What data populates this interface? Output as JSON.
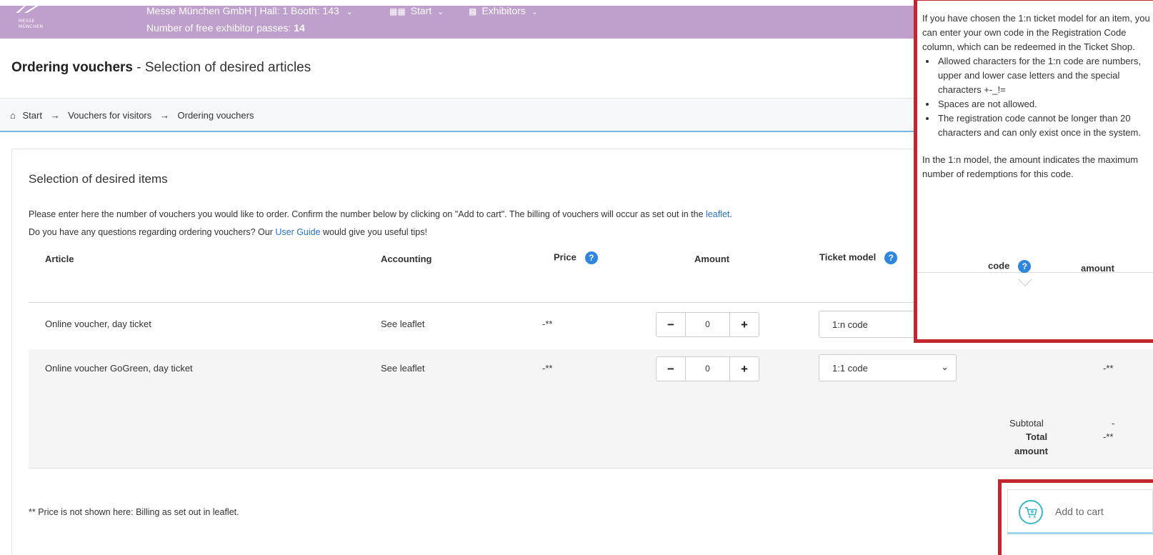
{
  "header": {
    "logo_line1": "MESSE",
    "logo_line2": "MÜNCHEN",
    "company": "Messe München GmbH | Hall: 1 Booth: 143",
    "free_passes_label": "Number of free exhibitor passes:",
    "free_passes_count": "14",
    "nav_start": "Start",
    "nav_exhibitors": "Exhibitors"
  },
  "page": {
    "title_bold": "Ordering vouchers",
    "title_rest": " - Selection of desired articles"
  },
  "breadcrumb": [
    "Start",
    "Vouchers for visitors",
    "Ordering vouchers"
  ],
  "section": {
    "heading": "Selection of desired items",
    "intro1_a": "Please enter here the number of vouchers you would like to order. Confirm the number below by clicking on \"Add to cart\". The billing of vouchers will occur as set out in the ",
    "intro1_link": "leaflet",
    "intro1_b": ".",
    "intro2_a": "Do you have any questions regarding ordering vouchers? Our ",
    "intro2_link": "User Guide",
    "intro2_b": " would give you useful tips!"
  },
  "table": {
    "headers": {
      "article": "Article",
      "accounting": "Accounting",
      "price": "Price",
      "amount": "Amount",
      "ticket_model": "Ticket model",
      "code": "code",
      "total_amount": "amount"
    },
    "rows": [
      {
        "article": "Online voucher, day ticket",
        "accounting": "See leaflet",
        "price": "-**",
        "amount": "0",
        "ticket_model": "1:n code",
        "total": "-**"
      },
      {
        "article": "Online voucher GoGreen, day ticket",
        "accounting": "See leaflet",
        "price": "-**",
        "amount": "0",
        "ticket_model": "1:1 code",
        "total": "-**"
      }
    ],
    "subtotal_label": "Subtotal",
    "subtotal_value": "-",
    "total_label_1": "Total",
    "total_label_2": "amount",
    "total_value": "-**"
  },
  "tooltip": {
    "intro": "If you have chosen the 1:n ticket model for an item, you can enter your own code in the Registration Code column, which can be redeemed in the Ticket Shop.",
    "bullets": [
      "Allowed characters for the 1:n code are numbers, upper and lower case letters and the special characters +-_!=",
      "Spaces are not allowed.",
      "The registration code cannot be longer than 20 characters and can only exist once in the system."
    ],
    "after": "In the 1:n model, the amount indicates the maximum number of redemptions for this code."
  },
  "cart": {
    "label": "Add to cart"
  },
  "footnote": "** Price is not shown here: Billing as set out in leaflet.",
  "colors": {
    "header_bg": "#bf9fcc",
    "link": "#2a73c4",
    "help_icon": "#2e86de",
    "highlight": "#c2262e",
    "cart_accent": "#3cb6c9"
  },
  "icons": {
    "home": "home-icon",
    "grid": "grid-icon",
    "building": "building-icon",
    "help": "help-icon",
    "cart": "cart-icon"
  }
}
